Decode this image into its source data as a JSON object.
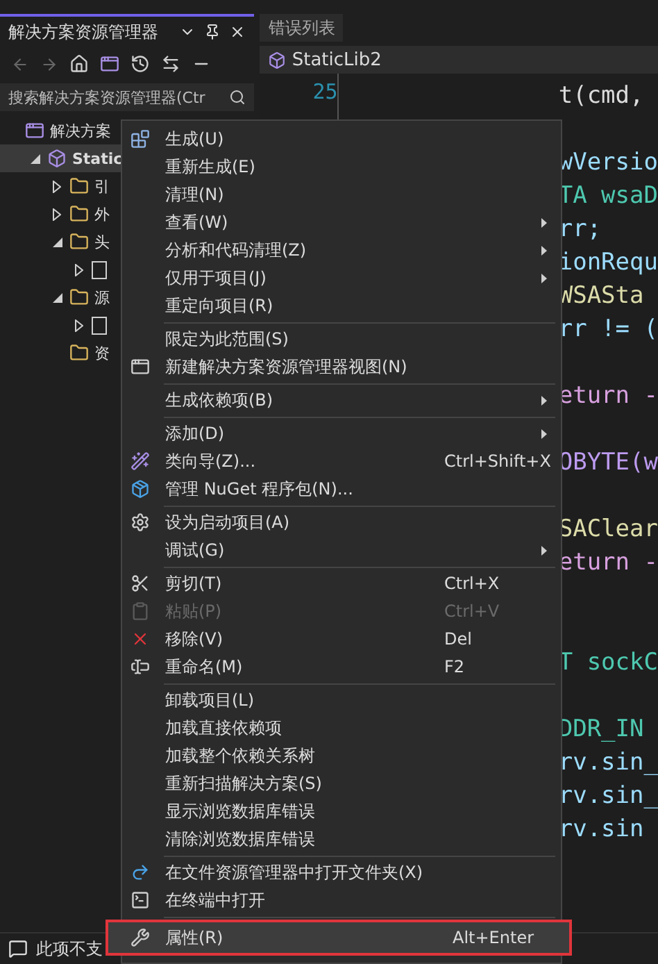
{
  "solution_explorer": {
    "title": "解决方案资源管理器",
    "search": {
      "placeholder": "搜索解决方案资源管理器(Ctr"
    },
    "tree": [
      {
        "label": "解决方案",
        "children": [
          {
            "label": "Static",
            "selected": true,
            "expanded": true,
            "children": [
              {
                "label": "引",
                "expanded": false
              },
              {
                "label": "外",
                "expanded": false
              },
              {
                "label": "头",
                "expanded": true,
                "children": [
                  {
                    "expanded": false
                  }
                ]
              },
              {
                "label": "源",
                "expanded": true,
                "children": [
                  {
                    "expanded": false
                  }
                ]
              },
              {
                "label": "资"
              }
            ]
          }
        ]
      }
    ]
  },
  "editor": {
    "tabs": [
      {
        "label": "错误列表"
      }
    ],
    "file_tab": {
      "label": "StaticLib2"
    },
    "line_number": "25",
    "code_lines": [
      {
        "text": "t(cmd,",
        "color": "#dcdcdc"
      },
      {
        "kind": "blank"
      },
      {
        "text": "wVersio",
        "color": "#9cdcfe"
      },
      {
        "text": "TA wsaD",
        "color": "#4ec9b0"
      },
      {
        "text": "rr;",
        "color": "#9cdcfe"
      },
      {
        "text": "ionRequ",
        "color": "#9cdcfe"
      },
      {
        "text": "WSASta",
        "color": "#dcdcaa"
      },
      {
        "text": "rr != (",
        "color": "#9cdcfe"
      },
      {
        "kind": "blank"
      },
      {
        "text": "eturn -",
        "color": "#d8a0df"
      },
      {
        "kind": "blank"
      },
      {
        "text": "OBYTE(w",
        "color": "#bd9bf0"
      },
      {
        "kind": "blank"
      },
      {
        "text": "SAClear",
        "color": "#dcdcaa"
      },
      {
        "text": "eturn -",
        "color": "#d8a0df"
      },
      {
        "kind": "blank"
      },
      {
        "kind": "blank"
      },
      {
        "text": "T sockC",
        "color": "#4ec9b0"
      },
      {
        "kind": "blank"
      },
      {
        "text": "DDR_IN",
        "color": "#4ec9b0"
      },
      {
        "text": "rv.sin_",
        "color": "#9cdcfe"
      },
      {
        "text": "rv.sin_",
        "color": "#9cdcfe"
      },
      {
        "text": "rv.sin",
        "color": "#9cdcfe"
      }
    ]
  },
  "context_menu": {
    "items": [
      {
        "kind": "item",
        "label": "生成(U)",
        "submenu": false,
        "disabled": false,
        "selected": false
      },
      {
        "kind": "item",
        "label": "重新生成(E)",
        "submenu": false,
        "disabled": false,
        "selected": false
      },
      {
        "kind": "item",
        "label": "清理(N)",
        "submenu": false,
        "disabled": false,
        "selected": false
      },
      {
        "kind": "item",
        "label": "查看(W)",
        "submenu": true,
        "disabled": false,
        "selected": false
      },
      {
        "kind": "item",
        "label": "分析和代码清理(Z)",
        "submenu": true,
        "disabled": false,
        "selected": false
      },
      {
        "kind": "item",
        "label": "仅用于项目(J)",
        "submenu": true,
        "disabled": false,
        "selected": false
      },
      {
        "kind": "item",
        "label": "重定向项目(R)",
        "submenu": false,
        "disabled": false,
        "selected": false
      },
      {
        "kind": "separator"
      },
      {
        "kind": "item",
        "label": "限定为此范围(S)",
        "submenu": false,
        "disabled": false,
        "selected": false
      },
      {
        "kind": "item",
        "label": "新建解决方案资源管理器视图(N)",
        "submenu": false,
        "disabled": false,
        "selected": false
      },
      {
        "kind": "separator"
      },
      {
        "kind": "item",
        "label": "生成依赖项(B)",
        "submenu": true,
        "disabled": false,
        "selected": false
      },
      {
        "kind": "separator"
      },
      {
        "kind": "item",
        "label": "添加(D)",
        "submenu": true,
        "disabled": false,
        "selected": false
      },
      {
        "kind": "item",
        "label": "类向导(Z)...",
        "shortcut": "Ctrl+Shift+X",
        "submenu": false,
        "disabled": false,
        "selected": false
      },
      {
        "kind": "item",
        "label": "管理 NuGet 程序包(N)...",
        "submenu": false,
        "disabled": false,
        "selected": false
      },
      {
        "kind": "separator"
      },
      {
        "kind": "item",
        "label": "设为启动项目(A)",
        "submenu": false,
        "disabled": false,
        "selected": false
      },
      {
        "kind": "item",
        "label": "调试(G)",
        "submenu": true,
        "disabled": false,
        "selected": false
      },
      {
        "kind": "separator"
      },
      {
        "kind": "item",
        "label": "剪切(T)",
        "shortcut": "Ctrl+X",
        "submenu": false,
        "disabled": false,
        "selected": false
      },
      {
        "kind": "item",
        "label": "粘贴(P)",
        "shortcut": "Ctrl+V",
        "submenu": false,
        "disabled": true,
        "selected": false
      },
      {
        "kind": "item",
        "label": "移除(V)",
        "shortcut": "Del",
        "submenu": false,
        "disabled": false,
        "selected": false
      },
      {
        "kind": "item",
        "label": "重命名(M)",
        "shortcut": "F2",
        "submenu": false,
        "disabled": false,
        "selected": false
      },
      {
        "kind": "separator"
      },
      {
        "kind": "item",
        "label": "卸载项目(L)",
        "submenu": false,
        "disabled": false,
        "selected": false
      },
      {
        "kind": "item",
        "label": "加载直接依赖项",
        "submenu": false,
        "disabled": false,
        "selected": false
      },
      {
        "kind": "item",
        "label": "加载整个依赖关系树",
        "submenu": false,
        "disabled": false,
        "selected": false
      },
      {
        "kind": "item",
        "label": "重新扫描解决方案(S)",
        "submenu": false,
        "disabled": false,
        "selected": false
      },
      {
        "kind": "item",
        "label": "显示浏览数据库错误",
        "submenu": false,
        "disabled": false,
        "selected": false
      },
      {
        "kind": "item",
        "label": "清除浏览数据库错误",
        "submenu": false,
        "disabled": false,
        "selected": false
      },
      {
        "kind": "separator"
      },
      {
        "kind": "item",
        "label": "在文件资源管理器中打开文件夹(X)",
        "submenu": false,
        "disabled": false,
        "selected": false
      },
      {
        "kind": "item",
        "label": "在终端中打开",
        "submenu": false,
        "disabled": false,
        "selected": false
      },
      {
        "kind": "separator"
      },
      {
        "kind": "item",
        "label": "属性(R)",
        "shortcut": "Alt+Enter",
        "submenu": false,
        "disabled": false,
        "selected": true
      }
    ]
  },
  "status_bar": {
    "text": "此项不支"
  }
}
